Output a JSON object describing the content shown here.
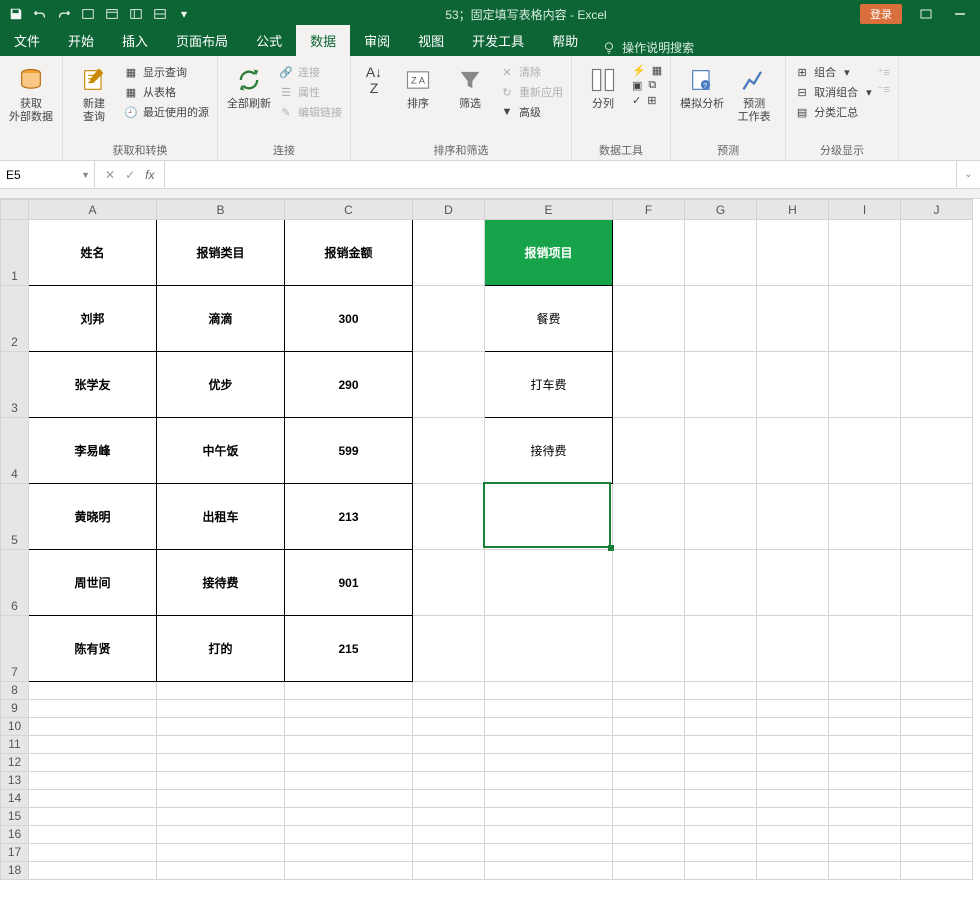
{
  "titlebar": {
    "title": "53；固定填写表格内容 - Excel",
    "login": "登录"
  },
  "tabs": {
    "file": "文件",
    "home": "开始",
    "insert": "插入",
    "layout": "页面布局",
    "formulas": "公式",
    "data": "数据",
    "review": "审阅",
    "view": "视图",
    "dev": "开发工具",
    "help": "帮助",
    "search": "操作说明搜索"
  },
  "ribbon": {
    "g1": {
      "label": "获取和转换",
      "external": "获取\n外部数据",
      "newquery": "新建\n查询",
      "showq": "显示查询",
      "fromtable": "从表格",
      "recent": "最近使用的源"
    },
    "g2": {
      "label": "连接",
      "refresh": "全部刷新",
      "conn": "连接",
      "prop": "属性",
      "edit": "编辑链接"
    },
    "g3": {
      "label": "排序和筛选",
      "sort": "排序",
      "filter": "筛选",
      "clear": "清除",
      "reapply": "重新应用",
      "adv": "高级"
    },
    "g4": {
      "label": "数据工具",
      "split": "分列"
    },
    "g5": {
      "label": "预测",
      "whatif": "模拟分析",
      "forecast": "预测\n工作表"
    },
    "g6": {
      "label": "分级显示",
      "group": "组合",
      "ungroup": "取消组合",
      "subtotal": "分类汇总"
    }
  },
  "formulaBar": {
    "cellRef": "E5",
    "formula": ""
  },
  "colHeaders": [
    "A",
    "B",
    "C",
    "D",
    "E",
    "F",
    "G",
    "H",
    "I",
    "J"
  ],
  "rowHeaders": [
    "1",
    "2",
    "3",
    "4",
    "5",
    "6",
    "7",
    "8",
    "9",
    "10",
    "11",
    "12",
    "13",
    "14",
    "15",
    "16",
    "17",
    "18"
  ],
  "table": {
    "headers": [
      "姓名",
      "报销类目",
      "报销金额"
    ],
    "rows": [
      [
        "刘邦",
        "滴滴",
        "300"
      ],
      [
        "张学友",
        "优步",
        "290"
      ],
      [
        "李易峰",
        "中午饭",
        "599"
      ],
      [
        "黄晓明",
        "出租车",
        "213"
      ],
      [
        "周世间",
        "接待费",
        "901"
      ],
      [
        "陈有贤",
        "打的",
        "215"
      ]
    ]
  },
  "elist": {
    "header": "报销项目",
    "items": [
      "餐费",
      "打车费",
      "接待费"
    ]
  }
}
